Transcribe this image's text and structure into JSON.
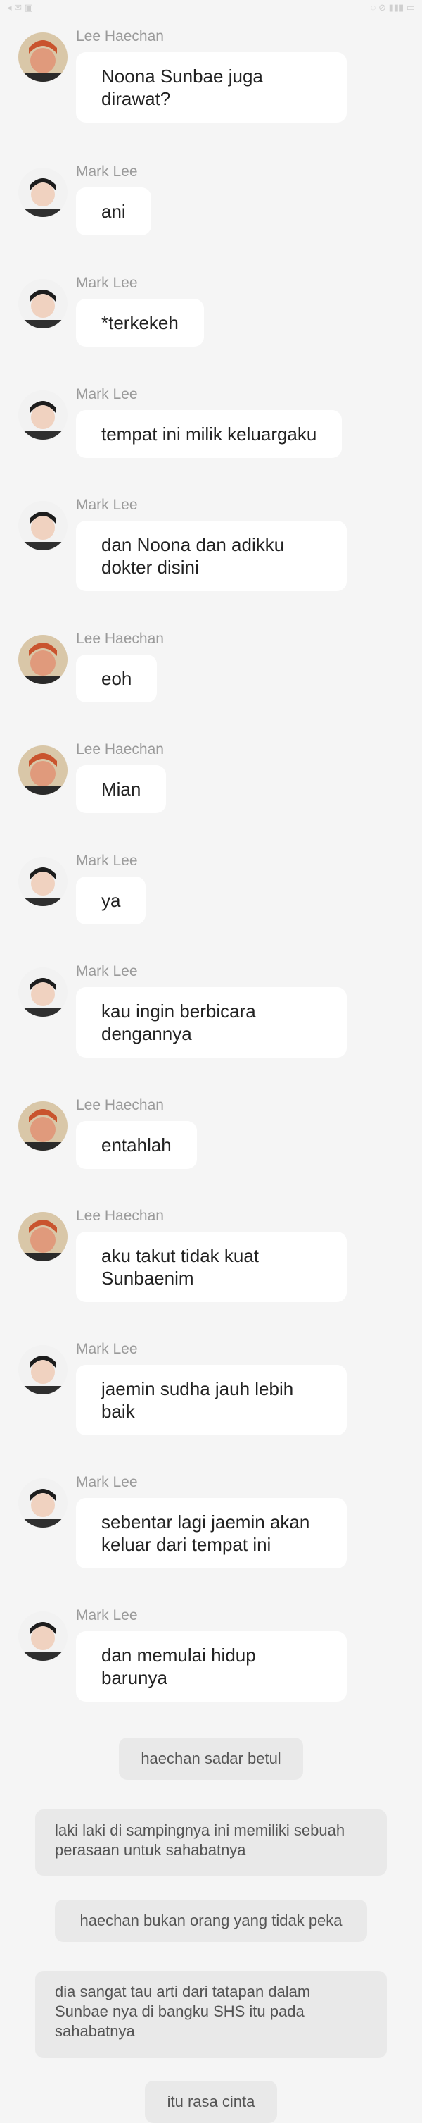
{
  "messages": [
    {
      "sender": "Lee Haechan",
      "avatar": "haechan-avatar",
      "text": "Noona Sunbae juga dirawat?"
    },
    {
      "sender": "Mark Lee",
      "avatar": "mark-avatar",
      "text": "ani"
    },
    {
      "sender": "Mark Lee",
      "avatar": "mark-avatar",
      "text": "*terkekeh"
    },
    {
      "sender": "Mark Lee",
      "avatar": "mark-avatar",
      "text": "tempat ini milik keluargaku"
    },
    {
      "sender": "Mark Lee",
      "avatar": "mark-avatar",
      "text": "dan Noona dan adikku dokter disini"
    },
    {
      "sender": "Lee Haechan",
      "avatar": "haechan-avatar",
      "text": "eoh"
    },
    {
      "sender": "Lee Haechan",
      "avatar": "haechan-avatar",
      "text": "Mian"
    },
    {
      "sender": "Mark Lee",
      "avatar": "mark-avatar",
      "text": "ya"
    },
    {
      "sender": "Mark Lee",
      "avatar": "mark-avatar",
      "text": "kau ingin berbicara dengannya"
    },
    {
      "sender": "Lee Haechan",
      "avatar": "haechan-avatar",
      "text": "entahlah"
    },
    {
      "sender": "Lee Haechan",
      "avatar": "haechan-avatar",
      "text": "aku takut tidak kuat Sunbaenim"
    },
    {
      "sender": "Mark Lee",
      "avatar": "mark-avatar",
      "text": "jaemin sudha jauh lebih baik"
    },
    {
      "sender": "Mark Lee",
      "avatar": "mark-avatar",
      "text": "sebentar lagi jaemin akan keluar dari tempat ini"
    },
    {
      "sender": "Mark Lee",
      "avatar": "mark-avatar",
      "text": "dan memulai hidup barunya"
    }
  ],
  "narrations": [
    {
      "text": "haechan sadar betul"
    },
    {
      "text": "laki laki di sampingnya ini memiliki sebuah perasaan untuk sahabatnya"
    },
    {
      "text": "haechan bukan orang yang tidak peka"
    },
    {
      "text": "dia sangat tau arti dari tatapan dalam Sunbae nya di bangku SHS itu pada sahabatnya"
    },
    {
      "text": "itu rasa cinta"
    }
  ],
  "colors": {
    "background": "#f5f5f5",
    "bubble": "#ffffff",
    "narration": "#e9e9e9",
    "sender": "#9a9a9a"
  }
}
